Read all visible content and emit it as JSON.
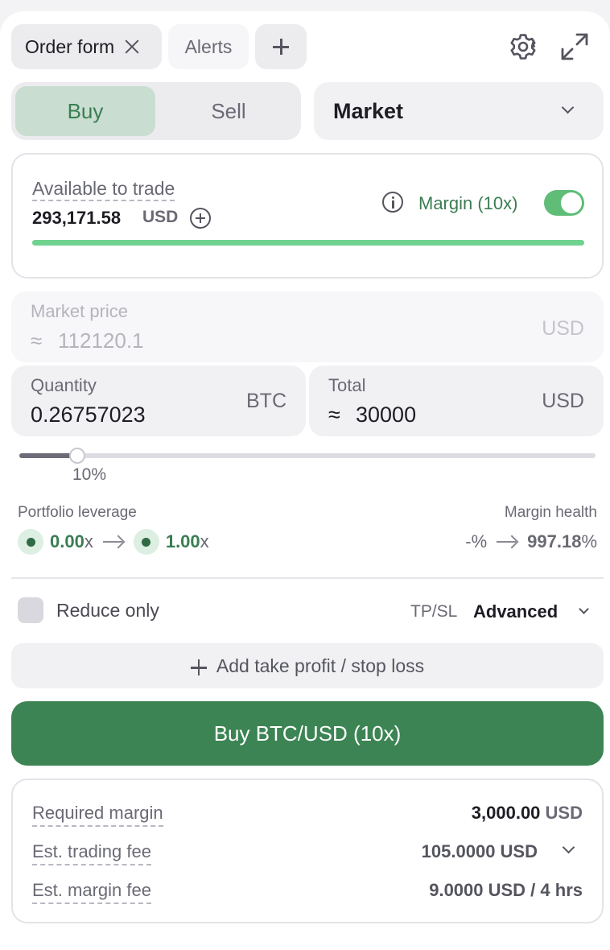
{
  "tabs": {
    "order_form": "Order form",
    "alerts": "Alerts"
  },
  "side": {
    "buy": "Buy",
    "sell": "Sell",
    "selected": "Buy"
  },
  "order_type": {
    "value": "Market"
  },
  "balance": {
    "label": "Available to trade",
    "amount": "293,171.58",
    "currency": "USD",
    "margin_label": "Margin (10x)",
    "margin_enabled": true,
    "bar_fraction": 1.0
  },
  "market_price": {
    "label": "Market price",
    "approx": "≈",
    "value": "112120.1",
    "unit": "USD"
  },
  "quantity": {
    "label": "Quantity",
    "value": "0.26757023",
    "unit": "BTC"
  },
  "total": {
    "label": "Total",
    "approx": "≈",
    "value": "30000",
    "unit": "USD"
  },
  "slider": {
    "percent_label": "10%",
    "fraction": 0.1
  },
  "leverage": {
    "label": "Portfolio leverage",
    "from": "0.00",
    "to": "1.00",
    "suffix": "x"
  },
  "margin_health": {
    "label": "Margin health",
    "from": "-%",
    "to": "997.18",
    "suffix": "%"
  },
  "reduce_only": {
    "label": "Reduce only",
    "checked": false
  },
  "tpsl": {
    "label": "TP/SL",
    "mode": "Advanced"
  },
  "add_tpsl": {
    "label": "Add take profit / stop loss"
  },
  "submit": {
    "label": "Buy BTC/USD (10x)"
  },
  "summary": {
    "required_margin": {
      "label": "Required margin",
      "value": "3,000.00",
      "unit": "USD"
    },
    "trading_fee": {
      "label": "Est. trading fee",
      "value": "105.0000 USD"
    },
    "margin_fee": {
      "label": "Est. margin fee",
      "value": "9.0000 USD / 4 hrs"
    }
  },
  "colors": {
    "accent": "#3c8454",
    "bar": "#6fd28e",
    "buy_tab": "#c9ded0"
  }
}
